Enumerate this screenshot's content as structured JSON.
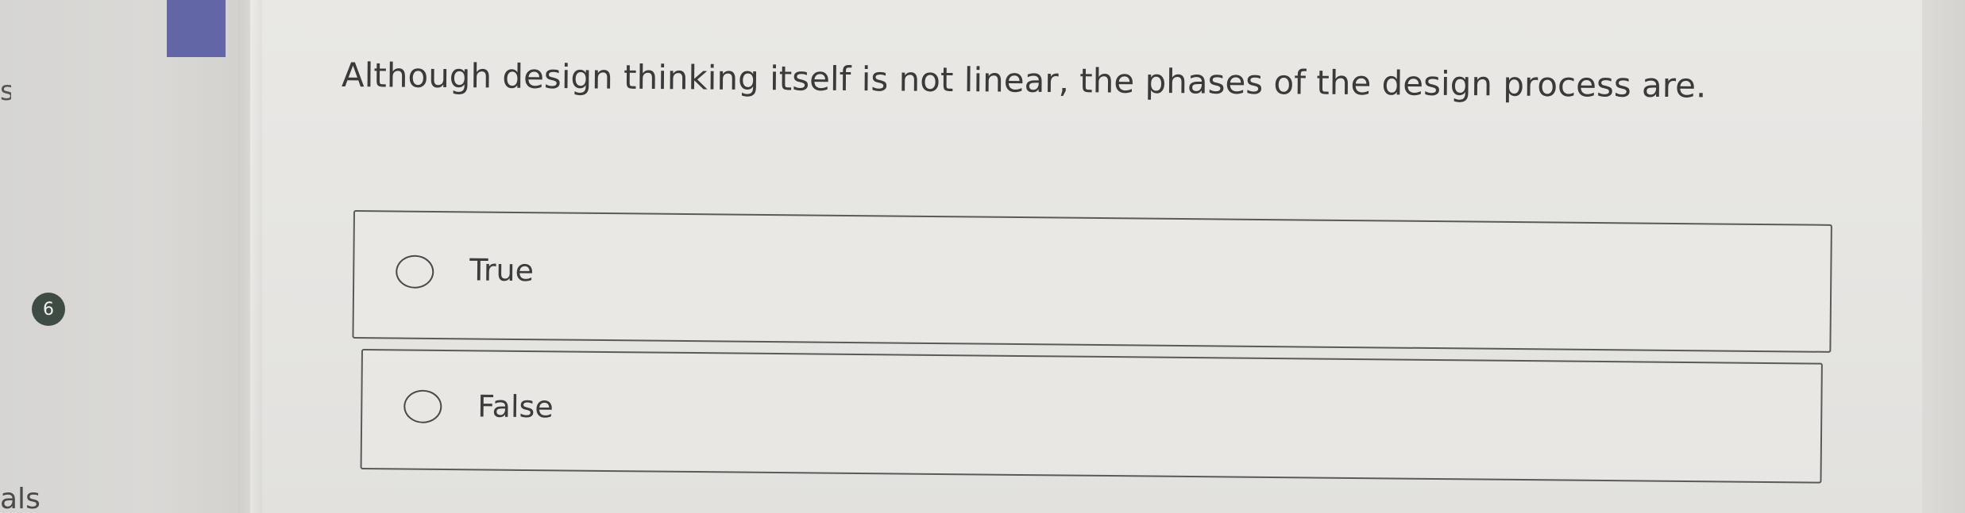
{
  "gutter": {
    "top_glyph": "s",
    "bottom_glyph": "als"
  },
  "question": {
    "number": "6",
    "text": "Although design thinking itself is not linear, the phases of the design process are."
  },
  "answers": [
    {
      "label": "True",
      "selected": false
    },
    {
      "label": "False",
      "selected": false
    }
  ],
  "colors": {
    "accent": "#6265a6",
    "number_badge": "#3f4c44",
    "border": "#5a5a5a",
    "background": "#e6e5e2"
  }
}
